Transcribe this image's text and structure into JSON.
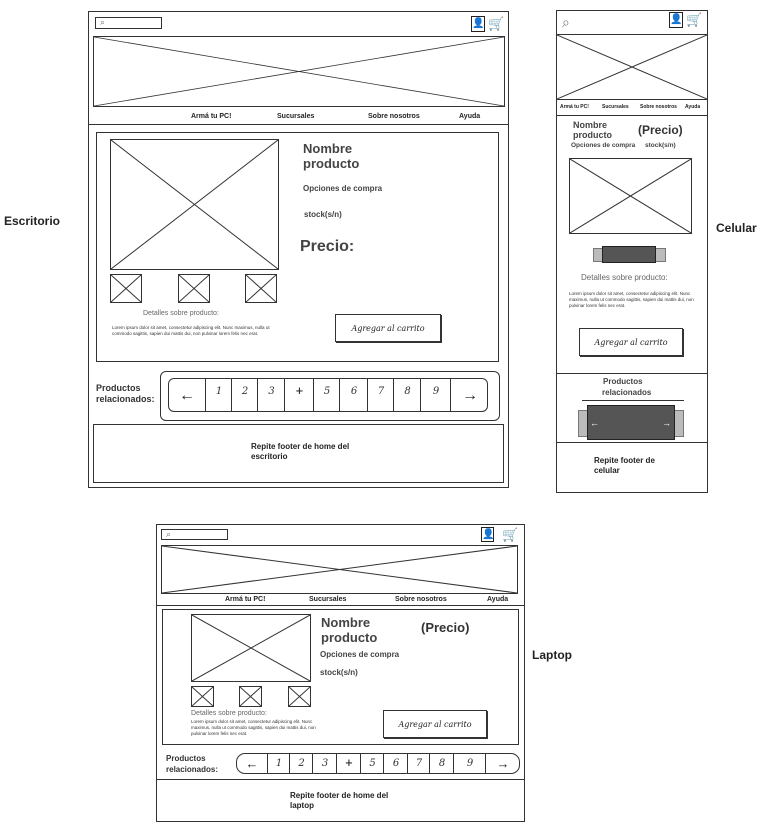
{
  "labels": {
    "desktop": "Escritorio",
    "mobile": "Celular",
    "laptop": "Laptop"
  },
  "nav": {
    "arma": "Armá tu PC!",
    "sucursales": "Sucursales",
    "nosotros": "Sobre nosotros",
    "ayuda": "Ayuda"
  },
  "icons": {
    "search": "search-icon",
    "user": "user-icon",
    "cart": "cart-icon"
  },
  "colors": {
    "cart": "#dd3322"
  },
  "product": {
    "name_line1": "Nombre",
    "name_line2": "producto",
    "options": "Opciones de compra",
    "stock": "stock(s/n)",
    "price_desktop": "Precio:",
    "price_paren": "(Precio)",
    "details": "Detalles sobre producto:",
    "lorem": "Lorem ipsum dolor sit amet, consectetur adipiscing elit. Nunc maximus, nulla ut commodo sagittis, sapien dui mattis dui, non pulvinar lorem felis nec erat.",
    "add_to_cart": "Agregar al carrito"
  },
  "related": {
    "line1": "Productos",
    "line2": "relacionados:",
    "mobile_line2": "relacionados"
  },
  "pagination": {
    "prev": "←",
    "next": "→",
    "pages": [
      "1",
      "2",
      "3",
      "+",
      "5",
      "6",
      "7",
      "8",
      "9"
    ]
  },
  "footer": {
    "desktop_line1": "Repite footer de home del",
    "desktop_line2": "escritorio",
    "mobile_line1": "Repite footer de",
    "mobile_line2": "celular",
    "laptop_line1": "Repite footer de home del",
    "laptop_line2": "laptop"
  }
}
